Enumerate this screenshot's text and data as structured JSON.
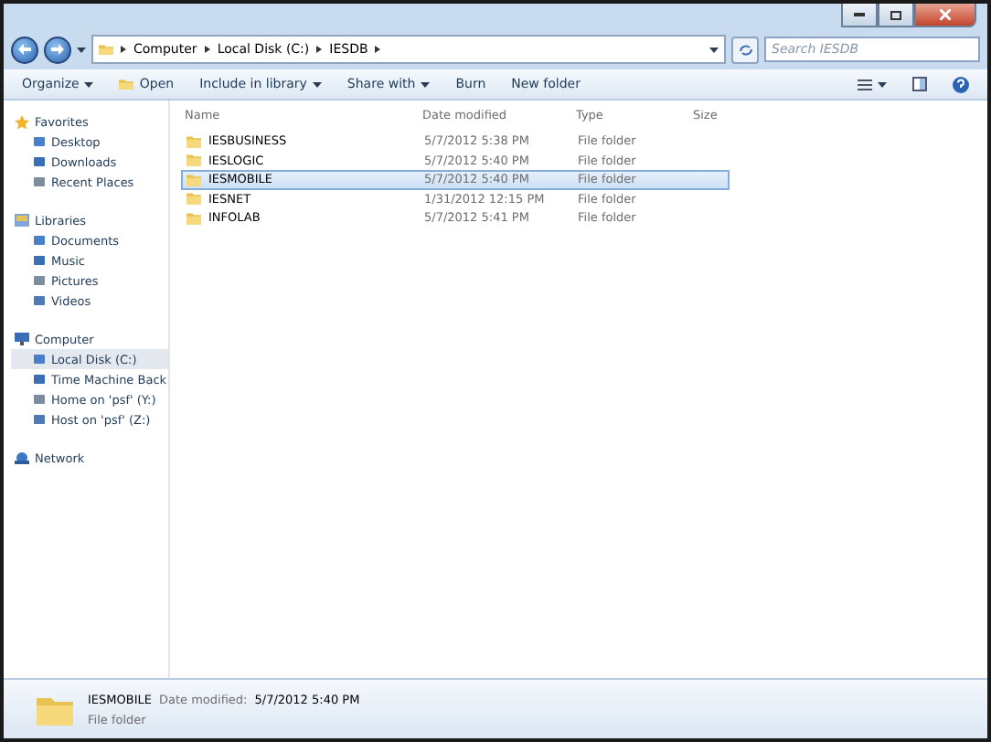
{
  "address_bar": {
    "crumbs": [
      "Computer",
      "Local Disk (C:)",
      "IESDB"
    ]
  },
  "search": {
    "placeholder": "Search IESDB"
  },
  "toolbar": {
    "buttons": [
      {
        "label": "Organize",
        "dropdown": true
      },
      {
        "label": "Open",
        "dropdown": false
      },
      {
        "label": "Include in library",
        "dropdown": true
      },
      {
        "label": "Share with",
        "dropdown": true
      },
      {
        "label": "Burn",
        "dropdown": false
      },
      {
        "label": "New folder",
        "dropdown": false
      }
    ]
  },
  "sidebar": {
    "sections": [
      {
        "label": "Favorites",
        "items": [
          {
            "label": "Desktop",
            "selected": false
          },
          {
            "label": "Downloads",
            "selected": false
          },
          {
            "label": "Recent Places",
            "selected": false
          }
        ]
      },
      {
        "label": "Libraries",
        "items": [
          {
            "label": "Documents",
            "selected": false
          },
          {
            "label": "Music",
            "selected": false
          },
          {
            "label": "Pictures",
            "selected": false
          },
          {
            "label": "Videos",
            "selected": false
          }
        ]
      },
      {
        "label": "Computer",
        "items": [
          {
            "label": "Local Disk (C:)",
            "selected": true
          },
          {
            "label": "Time Machine Back",
            "selected": false
          },
          {
            "label": "Home on 'psf' (Y:)",
            "selected": false
          },
          {
            "label": "Host on 'psf' (Z:)",
            "selected": false
          }
        ]
      },
      {
        "label": "Network"
      }
    ]
  },
  "table": {
    "columns": [
      "Name",
      "Date modified",
      "Type",
      "Size"
    ],
    "rows": [
      {
        "name": "IESBUSINESS",
        "date": "5/7/2012 5:38 PM",
        "type": "File folder",
        "selected": false
      },
      {
        "name": "IESLOGIC",
        "date": "5/7/2012 5:40 PM",
        "type": "File folder",
        "selected": false
      },
      {
        "name": "IESMOBILE",
        "date": "5/7/2012 5:40 PM",
        "type": "File folder",
        "selected": true
      },
      {
        "name": "IESNET",
        "date": "1/31/2012 12:15 PM",
        "type": "File folder",
        "selected": false
      },
      {
        "name": "INFOLAB",
        "date": "5/7/2012 5:41 PM",
        "type": "File folder",
        "selected": false
      }
    ]
  },
  "details": {
    "name": "IESMOBILE",
    "date_label": "Date modified:",
    "date": "5/7/2012 5:40 PM",
    "type": "File folder"
  }
}
